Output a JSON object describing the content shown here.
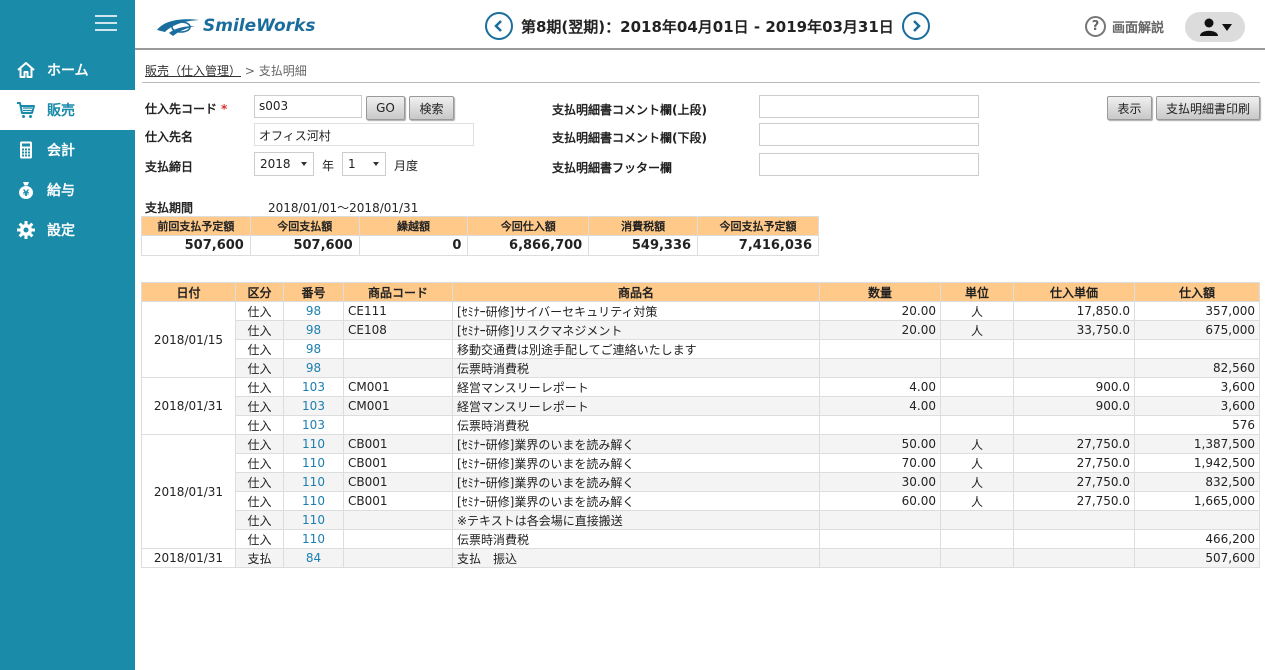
{
  "sidebar": {
    "items": [
      {
        "label": "ホーム",
        "icon": "home-icon"
      },
      {
        "label": "販売",
        "icon": "cart-icon"
      },
      {
        "label": "会計",
        "icon": "calculator-icon"
      },
      {
        "label": "給与",
        "icon": "money-bag-icon"
      },
      {
        "label": "設定",
        "icon": "gear-icon"
      }
    ]
  },
  "header": {
    "logo_text": "SmileWorks",
    "period": "第8期(翌期)：2018年04月01日 - 2019年03月31日",
    "help_label": "画面解説"
  },
  "breadcrumb": {
    "link": "販売（仕入管理）",
    "separator": ">",
    "current": "支払明細"
  },
  "form": {
    "supplier_code_label": "仕入先コード",
    "required_mark": "*",
    "supplier_code_value": "s003",
    "go_label": "GO",
    "search_label": "検索",
    "supplier_name_label": "仕入先名",
    "supplier_name_value": "オフィス河村",
    "closing_label": "支払締日",
    "year_value": "2018",
    "year_unit": "年",
    "month_value": "1",
    "month_unit": "月度",
    "comment_upper_label": "支払明細書コメント欄(上段)",
    "comment_lower_label": "支払明細書コメント欄(下段)",
    "footer_label": "支払明細書フッター欄",
    "show_label": "表示",
    "print_label": "支払明細書印刷"
  },
  "summary": {
    "period_label": "支払期間",
    "period_value": "2018/01/01～2018/01/31",
    "headers": [
      "前回支払予定額",
      "今回支払額",
      "繰越額",
      "今回仕入額",
      "消費税額",
      "今回支払予定額"
    ],
    "values": [
      "507,600",
      "507,600",
      "0",
      "6,866,700",
      "549,336",
      "7,416,036"
    ]
  },
  "table": {
    "headers": [
      "日付",
      "区分",
      "番号",
      "商品コード",
      "商品名",
      "数量",
      "単位",
      "仕入単価",
      "仕入額"
    ],
    "groups": [
      {
        "date": "2018/01/15",
        "rows": [
          [
            "仕入",
            "98",
            "CE111",
            "[ｾﾐﾅｰ研修]サイバーセキュリティ対策",
            "20.00",
            "人",
            "17,850.0",
            "357,000"
          ],
          [
            "仕入",
            "98",
            "CE108",
            "[ｾﾐﾅｰ研修]リスクマネジメント",
            "20.00",
            "人",
            "33,750.0",
            "675,000"
          ],
          [
            "仕入",
            "98",
            "",
            "移動交通費は別途手配してご連絡いたします",
            "",
            "",
            "",
            ""
          ],
          [
            "仕入",
            "98",
            "",
            "伝票時消費税",
            "",
            "",
            "",
            "82,560"
          ]
        ]
      },
      {
        "date": "2018/01/31",
        "rows": [
          [
            "仕入",
            "103",
            "CM001",
            "経営マンスリーレポート",
            "4.00",
            "",
            "900.0",
            "3,600"
          ],
          [
            "仕入",
            "103",
            "CM001",
            "経営マンスリーレポート",
            "4.00",
            "",
            "900.0",
            "3,600"
          ],
          [
            "仕入",
            "103",
            "",
            "伝票時消費税",
            "",
            "",
            "",
            "576"
          ]
        ]
      },
      {
        "date": "2018/01/31",
        "rows": [
          [
            "仕入",
            "110",
            "CB001",
            "[ｾﾐﾅｰ研修]業界のいまを読み解く",
            "50.00",
            "人",
            "27,750.0",
            "1,387,500"
          ],
          [
            "仕入",
            "110",
            "CB001",
            "[ｾﾐﾅｰ研修]業界のいまを読み解く",
            "70.00",
            "人",
            "27,750.0",
            "1,942,500"
          ],
          [
            "仕入",
            "110",
            "CB001",
            "[ｾﾐﾅｰ研修]業界のいまを読み解く",
            "30.00",
            "人",
            "27,750.0",
            "832,500"
          ],
          [
            "仕入",
            "110",
            "CB001",
            "[ｾﾐﾅｰ研修]業界のいまを読み解く",
            "60.00",
            "人",
            "27,750.0",
            "1,665,000"
          ],
          [
            "仕入",
            "110",
            "",
            "※テキストは各会場に直接搬送",
            "",
            "",
            "",
            ""
          ],
          [
            "仕入",
            "110",
            "",
            "伝票時消費税",
            "",
            "",
            "",
            "466,200"
          ]
        ]
      },
      {
        "date": "2018/01/31",
        "rows": [
          [
            "支払",
            "84",
            "",
            "支払　振込",
            "",
            "",
            "",
            "507,600"
          ]
        ]
      }
    ]
  },
  "colors": {
    "sidebar": "#1a8ba9",
    "brand": "#1a6d9c",
    "table_header": "#ffc98a",
    "link_number": "#1a7fb0"
  }
}
